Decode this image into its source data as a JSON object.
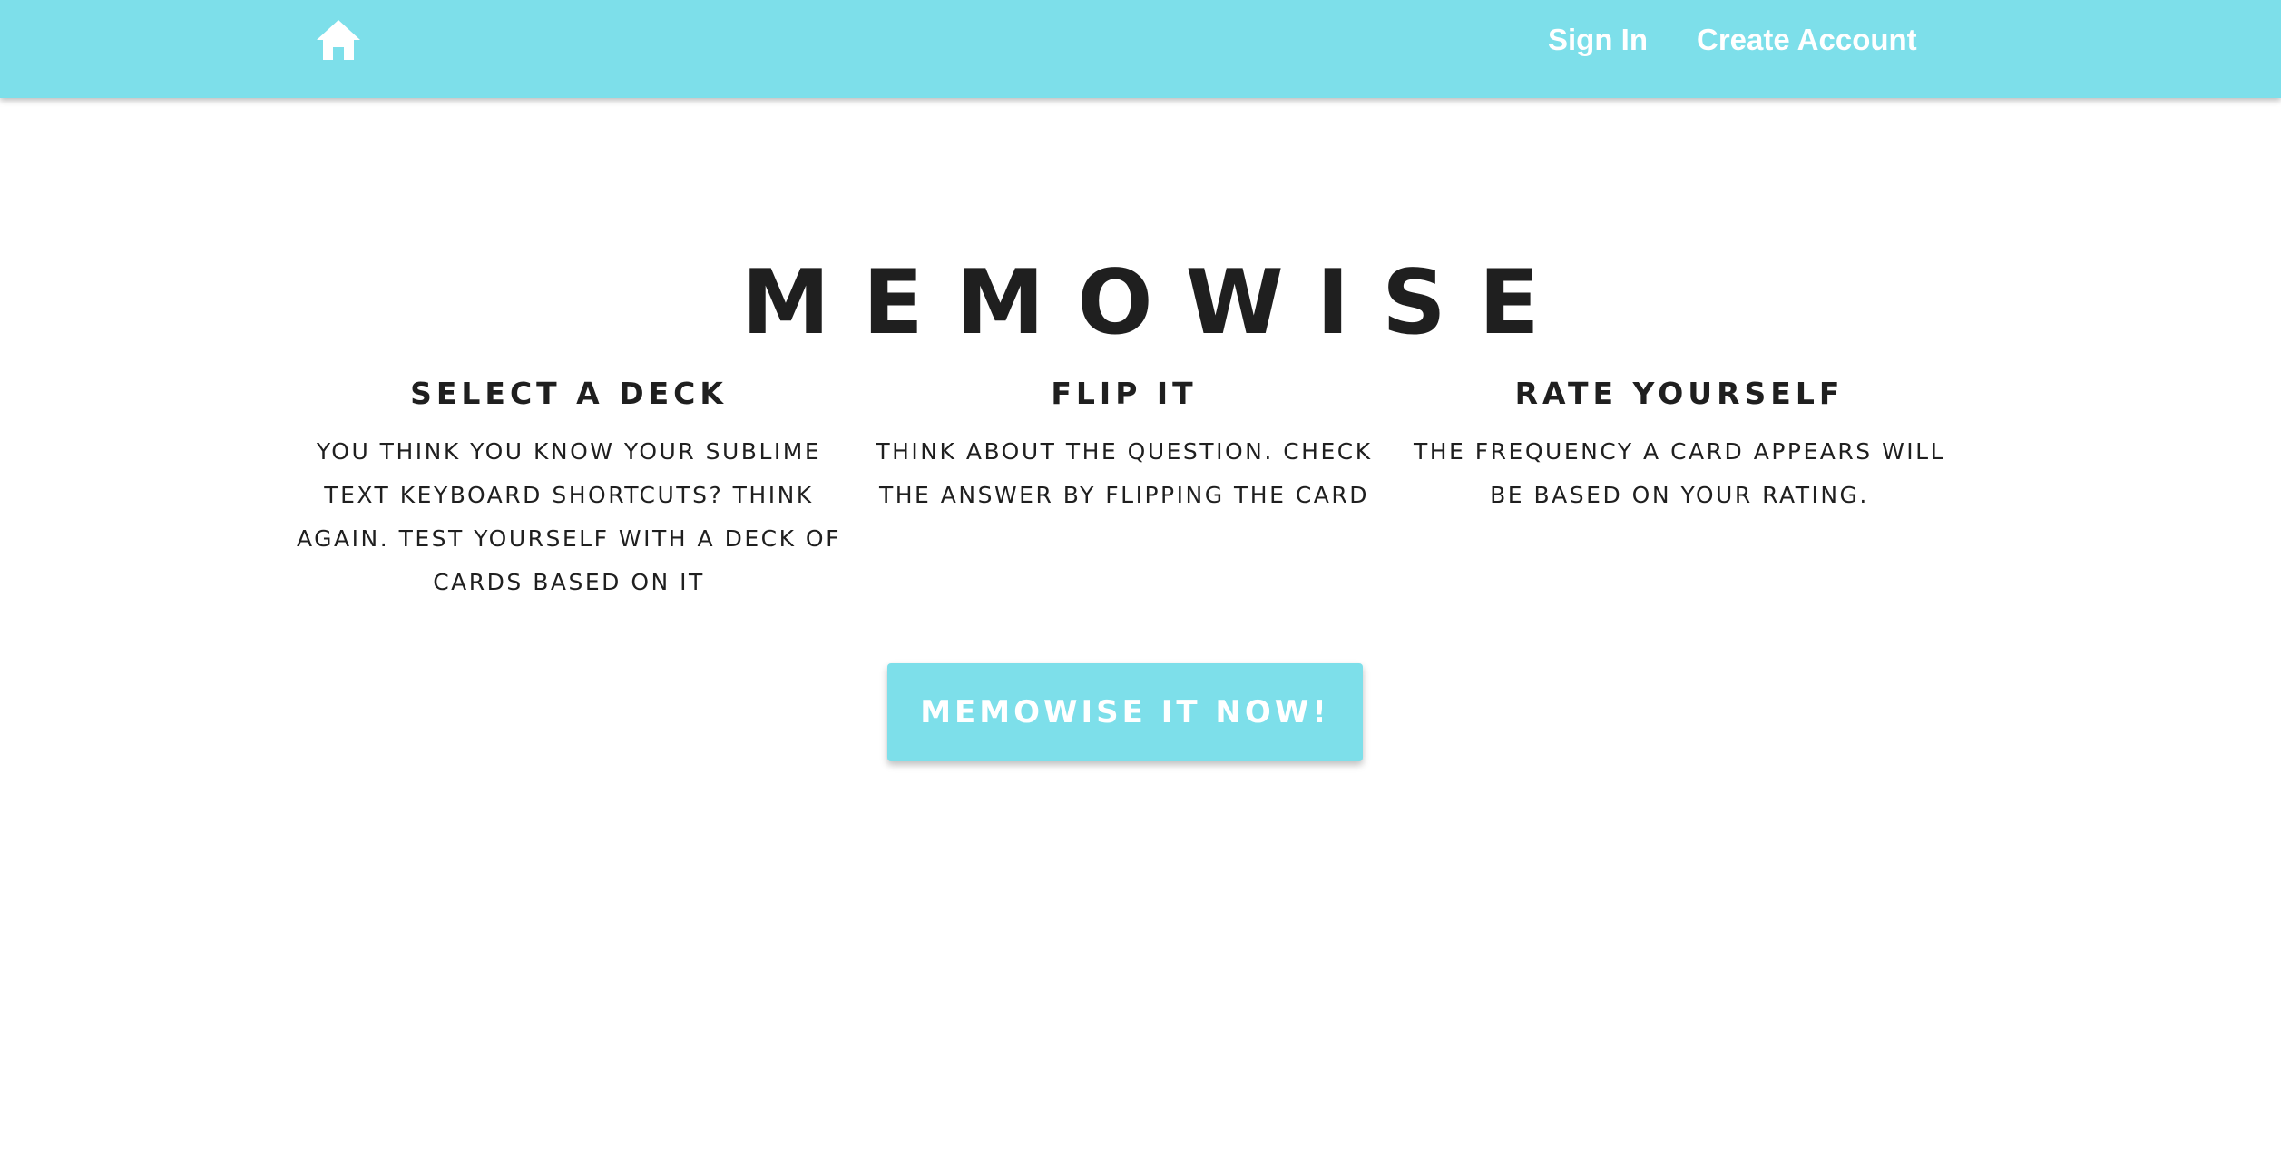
{
  "theme": {
    "accent": "#7ddfea",
    "text": "#1f1f1f",
    "nav_text": "#ffffff"
  },
  "nav": {
    "home_icon": "home-icon",
    "sign_in": "Sign In",
    "create_account": "Create Account"
  },
  "hero": {
    "title": "MEMOWISE"
  },
  "features": [
    {
      "heading": "SELECT A DECK",
      "text": "YOU THINK YOU KNOW YOUR SUBLIME TEXT KEYBOARD SHORTCUTS? THINK AGAIN. TEST YOURSELF WITH A DECK OF CARDS BASED ON IT"
    },
    {
      "heading": "FLIP IT",
      "text": "THINK ABOUT THE QUESTION. CHECK THE ANSWER BY FLIPPING THE CARD"
    },
    {
      "heading": "RATE YOURSELF",
      "text": "THE FREQUENCY A CARD APPEARS WILL BE BASED ON YOUR RATING."
    }
  ],
  "cta": {
    "label": "MEMOWISE IT NOW!"
  }
}
